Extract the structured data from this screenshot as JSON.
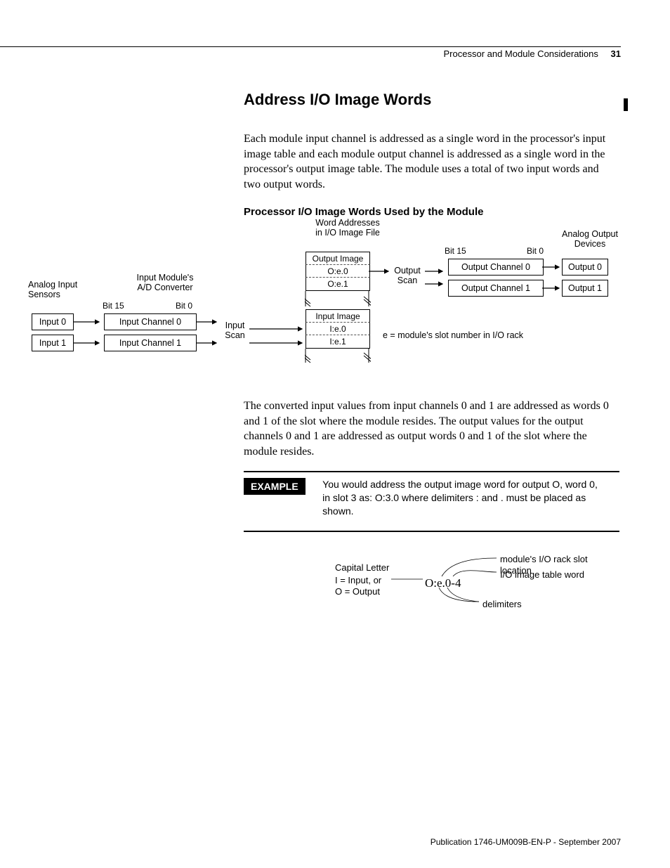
{
  "header": {
    "section": "Processor and Module Considerations",
    "page": "31"
  },
  "title": "Address I/O Image Words",
  "intro": "Each module input channel is addressed as a single word in the processor's input image table and each module output channel is addressed as a single word in the processor's output image table. The module uses a total of two input words and two output words.",
  "subhead": "Processor I/O Image Words Used by the Module",
  "diagram": {
    "word_addresses_label": "Word Addresses\nin I/O Image File",
    "analog_output_label": "Analog Output\nDevices",
    "analog_input_label": "Analog Input\nSensors",
    "input_module_label": "Input Module's\nA/D Converter",
    "bit15": "Bit 15",
    "bit0": "Bit 0",
    "output_image": "Output Image",
    "oe0": "O:e.0",
    "oe1": "O:e.1",
    "output_scan": "Output\nScan",
    "out_ch0": "Output Channel 0",
    "out_ch1": "Output Channel 1",
    "out0": "Output 0",
    "out1": "Output 1",
    "input_image": "Input Image",
    "ie0": "I:e.0",
    "ie1": "I:e.1",
    "slot_note": "e = module's slot number in I/O rack",
    "input0": "Input 0",
    "input1": "Input 1",
    "in_ch0": "Input Channel 0",
    "in_ch1": "Input Channel 1",
    "input_scan": "Input\nScan"
  },
  "para2": "The converted input values from input channels 0 and 1 are addressed as words 0 and 1 of the slot where the module resides. The output values for the output channels 0 and 1 are addressed as output words 0 and 1 of the slot where the module resides.",
  "example": {
    "badge": "EXAMPLE",
    "text": "You would address the output image word for output O, word 0, in slot 3 as: O:3.0 where delimiters : and . must be placed as shown."
  },
  "addr": {
    "left1": "Capital Letter",
    "left2": "I = Input, or",
    "left3": "O = Output",
    "formula": "O:e.0-4",
    "r1": "module's I/O rack slot location",
    "r2": "I/O image table word",
    "r3": "delimiters"
  },
  "footer": "Publication 1746-UM009B-EN-P - September 2007"
}
